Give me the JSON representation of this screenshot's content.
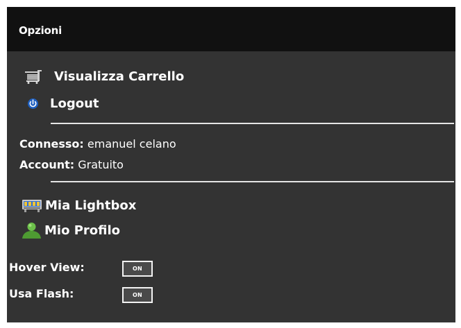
{
  "header": {
    "title": "Opzioni"
  },
  "links": {
    "cart_label": "Visualizza Carrello",
    "logout_label": "Logout",
    "lightbox_label": "Mia Lightbox",
    "profile_label": "Mio Profilo"
  },
  "account": {
    "connected_label": "Connesso:",
    "connected_value": "emanuel celano",
    "account_label": "Account:",
    "account_value": "Gratuito"
  },
  "toggles": {
    "hover_label": "Hover View:",
    "hover_state": "ON",
    "flash_label": "Usa Flash:",
    "flash_state": "ON"
  },
  "icons": {
    "cart": "cart-icon",
    "logout": "power-icon",
    "lightbox": "lightbox-icon",
    "profile": "user-icon"
  },
  "colors": {
    "panel_bg": "#333333",
    "header_bg": "#111111",
    "text": "#ffffff",
    "toggle_bg": "#4a4a4a"
  }
}
